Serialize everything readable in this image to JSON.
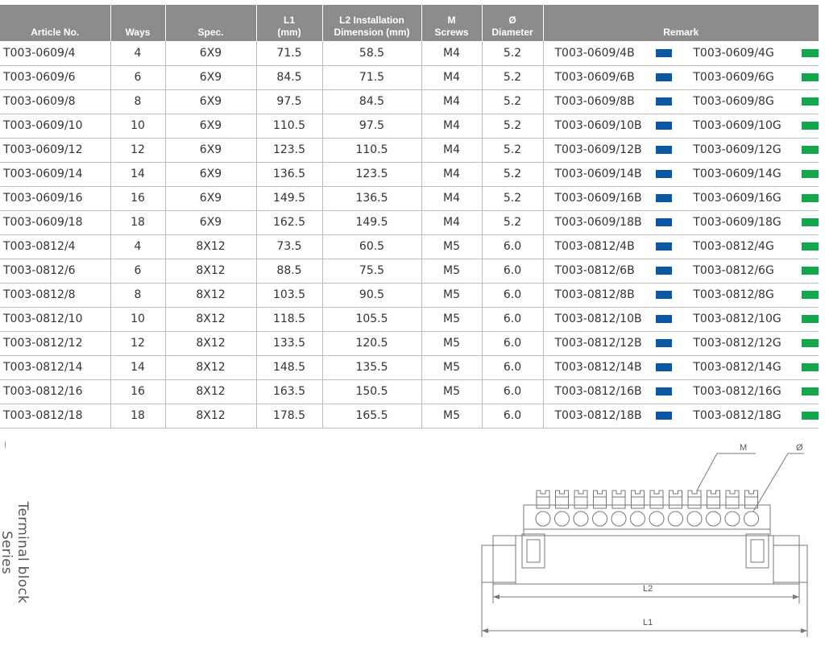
{
  "table": {
    "headers": [
      "Article No.",
      "Ways",
      "Spec.",
      "L1\n(mm)",
      "L2 Installation\nDimension (mm)",
      "M\nScrews",
      "Ø\nDiameter",
      "Remark"
    ],
    "rows": [
      [
        "T003-0609/4",
        "4",
        "6X9",
        "71.5",
        "58.5",
        "M4",
        "5.2",
        "T003-0609/4B",
        "T003-0609/4G"
      ],
      [
        "T003-0609/6",
        "6",
        "6X9",
        "84.5",
        "71.5",
        "M4",
        "5.2",
        "T003-0609/6B",
        "T003-0609/6G"
      ],
      [
        "T003-0609/8",
        "8",
        "6X9",
        "97.5",
        "84.5",
        "M4",
        "5.2",
        "T003-0609/8B",
        "T003-0609/8G"
      ],
      [
        "T003-0609/10",
        "10",
        "6X9",
        "110.5",
        "97.5",
        "M4",
        "5.2",
        "T003-0609/10B",
        "T003-0609/10G"
      ],
      [
        "T003-0609/12",
        "12",
        "6X9",
        "123.5",
        "110.5",
        "M4",
        "5.2",
        "T003-0609/12B",
        "T003-0609/12G"
      ],
      [
        "T003-0609/14",
        "14",
        "6X9",
        "136.5",
        "123.5",
        "M4",
        "5.2",
        "T003-0609/14B",
        "T003-0609/14G"
      ],
      [
        "T003-0609/16",
        "16",
        "6X9",
        "149.5",
        "136.5",
        "M4",
        "5.2",
        "T003-0609/16B",
        "T003-0609/16G"
      ],
      [
        "T003-0609/18",
        "18",
        "6X9",
        "162.5",
        "149.5",
        "M4",
        "5.2",
        "T003-0609/18B",
        "T003-0609/18G"
      ],
      [
        "T003-0812/4",
        "4",
        "8X12",
        "73.5",
        "60.5",
        "M5",
        "6.0",
        "T003-0812/4B",
        "T003-0812/4G"
      ],
      [
        "T003-0812/6",
        "6",
        "8X12",
        "88.5",
        "75.5",
        "M5",
        "6.0",
        "T003-0812/6B",
        "T003-0812/6G"
      ],
      [
        "T003-0812/8",
        "8",
        "8X12",
        "103.5",
        "90.5",
        "M5",
        "6.0",
        "T003-0812/8B",
        "T003-0812/8G"
      ],
      [
        "T003-0812/10",
        "10",
        "8X12",
        "118.5",
        "105.5",
        "M5",
        "6.0",
        "T003-0812/10B",
        "T003-0812/10G"
      ],
      [
        "T003-0812/12",
        "12",
        "8X12",
        "133.5",
        "120.5",
        "M5",
        "6.0",
        "T003-0812/12B",
        "T003-0812/12G"
      ],
      [
        "T003-0812/14",
        "14",
        "8X12",
        "148.5",
        "135.5",
        "M5",
        "6.0",
        "T003-0812/14B",
        "T003-0812/14G"
      ],
      [
        "T003-0812/16",
        "16",
        "8X12",
        "163.5",
        "150.5",
        "M5",
        "6.0",
        "T003-0812/16B",
        "T003-0812/16G"
      ],
      [
        "T003-0812/18",
        "18",
        "8X12",
        "178.5",
        "165.5",
        "M5",
        "6.0",
        "T003-0812/18B",
        "T003-0812/18G"
      ]
    ],
    "swatch_colors": {
      "blue": "#0a57a5",
      "green": "#11a84b"
    },
    "header_bg": "#8c8c8c"
  },
  "side_title": "Terminal block Series",
  "diagram": {
    "labels": {
      "m": "M",
      "diameter": "Ø",
      "l2": "L2",
      "l1": "L1"
    }
  }
}
